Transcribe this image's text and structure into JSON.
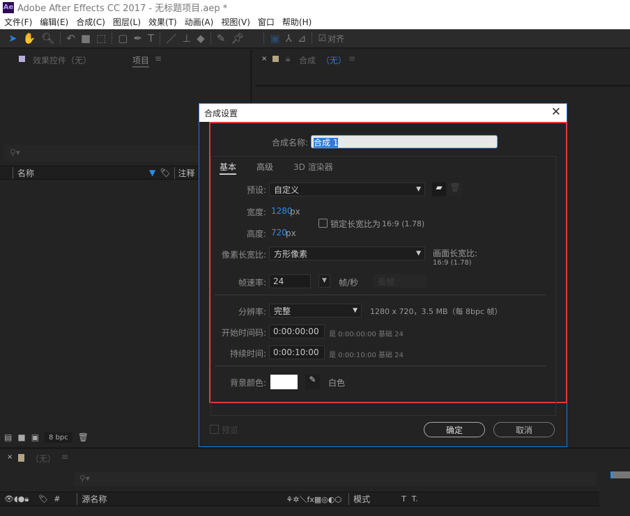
{
  "window": {
    "logo": "Ae",
    "title": "Adobe After Effects CC 2017 - 无标题项目.aep *"
  },
  "menu": [
    "文件(F)",
    "编辑(E)",
    "合成(C)",
    "图层(L)",
    "效果(T)",
    "动画(A)",
    "视图(V)",
    "窗口",
    "帮助(H)"
  ],
  "toolbar": {
    "align_label": "对齐",
    "align_checked": true
  },
  "left_panel": {
    "tab_effects": "效果控件（无）",
    "tab_project": "项目",
    "col_name": "名称",
    "col_comment": "注释",
    "bpc": "8 bpc"
  },
  "comp_panel": {
    "tab": "合成",
    "tab_value": "（无）"
  },
  "timeline": {
    "tab": "（无）",
    "col_source": "源名称",
    "col_mode": "模式",
    "col_t": "T",
    "col_trk": "T."
  },
  "dialog": {
    "title": "合成设置",
    "name_label": "合成名称:",
    "name_value": "合成 1",
    "tabs": [
      "基本",
      "高级",
      "3D 渲染器"
    ],
    "active_tab": "基本",
    "preset_label": "预设:",
    "preset_value": "自定义",
    "width_label": "宽度:",
    "width_value": "1280",
    "height_label": "高度:",
    "height_value": "720",
    "unit": "px",
    "lock_label": "锁定长宽比为",
    "lock_ratio": "16:9 (1.78)",
    "lock_checked": false,
    "par_label": "像素长宽比:",
    "par_value": "方形像素",
    "frame_ratio_label": "画面长宽比:",
    "frame_ratio_value": "16:9 (1.78)",
    "fps_label": "帧速率:",
    "fps_value": "24",
    "fps_unit": "帧/秒",
    "drop_frame": "丢帧",
    "res_label": "分辨率:",
    "res_value": "完整",
    "res_info": "1280 x 720，3.5 MB（每 8bpc 帧）",
    "start_label": "开始时间码:",
    "start_value": "0:00:00:00",
    "start_info": "是 0:00:00:00  基础 24",
    "dur_label": "持续时间:",
    "dur_value": "0:00:10:00",
    "dur_info": "是 0:00:10:00  基础 24",
    "bg_label": "背景颜色:",
    "bg_color": "#ffffff",
    "bg_name": "白色",
    "preview_label": "预览",
    "ok": "确定",
    "cancel": "取消"
  },
  "colors": {
    "accent": "#2d8ceb",
    "highlight": "#e0393e"
  }
}
